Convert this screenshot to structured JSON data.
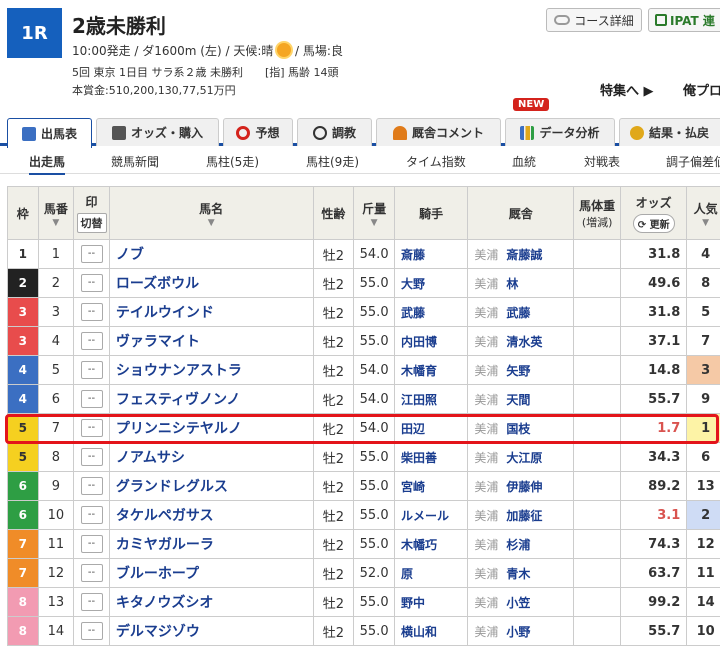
{
  "race": {
    "badge": "1R",
    "title": "2歳未勝利",
    "info_line1": "10:00発走 / ダ1600m (左) / 天候:晴",
    "info_line1b": "/ 馬場:良",
    "info_line2": "5回 東京 1日目 サラ系２歳 未勝利　　[指] 馬齢 14頭",
    "info_line3": "本賞金:510,200,130,77,51万円"
  },
  "header_buttons": {
    "course": "コース詳細",
    "ipat": "IPAT 連"
  },
  "header_links": {
    "feature": "特集へ ▶",
    "my": "俺プロ"
  },
  "tabs": [
    {
      "label": "出馬表",
      "icon": "table-icon",
      "color": "#3b6fc2"
    },
    {
      "label": "オッズ・購入",
      "icon": "ticket-icon",
      "color": "#555555"
    },
    {
      "label": "予想",
      "icon": "target-icon",
      "color": "#d4231c"
    },
    {
      "label": "調教",
      "icon": "stopwatch-icon",
      "color": "#333333"
    },
    {
      "label": "厩舎コメント",
      "icon": "stable-icon",
      "color": "#e07b1a"
    },
    {
      "label": "データ分析",
      "icon": "bar-chart-icon",
      "color": "#3b6fc2"
    },
    {
      "label": "結果・払戻",
      "icon": "coins-icon",
      "color": "#e0a81a"
    }
  ],
  "new_badge": "NEW",
  "subnav": [
    "出走馬",
    "競馬新聞",
    "馬柱(5走)",
    "馬柱(9走)",
    "タイム指数",
    "血統",
    "対戦表",
    "調子偏差値"
  ],
  "columns": {
    "waku": "枠",
    "umaban": "馬番",
    "mark": "印",
    "mark_toggle": "切替",
    "horse": "馬名",
    "sexage": "性齢",
    "weight": "斤量",
    "jockey": "騎手",
    "trainer": "厩舎",
    "body": "馬体重",
    "body_sub": "(増減)",
    "odds": "オッズ",
    "odds_update": "更新",
    "pop": "人気"
  },
  "mark_placeholder": "--",
  "colors": {
    "waku1": "#ffffff",
    "waku2": "#222222",
    "waku3": "#e84c4c",
    "waku4": "#3b6fc2",
    "waku5": "#f5d020",
    "waku6": "#2e9e44",
    "waku7": "#f08c28",
    "waku8": "#f29bb2",
    "pop1": "#fdf3a6",
    "pop2": "#cfdcf5",
    "pop3": "#f5c9a6",
    "highlight": "#e3141a"
  },
  "rows": [
    {
      "waku": "1",
      "umaban": "1",
      "horse": "ノブ",
      "sexage": "牡2",
      "weight": "54.0",
      "jockey": "斎藤",
      "region": "美浦",
      "trainer": "斎藤誠",
      "odds": "31.8",
      "pop": "4"
    },
    {
      "waku": "2",
      "umaban": "2",
      "horse": "ローズボウル",
      "sexage": "牡2",
      "weight": "55.0",
      "jockey": "大野",
      "region": "美浦",
      "trainer": "林",
      "odds": "49.6",
      "pop": "8"
    },
    {
      "waku": "3",
      "umaban": "3",
      "horse": "テイルウインド",
      "sexage": "牡2",
      "weight": "55.0",
      "jockey": "武藤",
      "region": "美浦",
      "trainer": "武藤",
      "odds": "31.8",
      "pop": "5"
    },
    {
      "waku": "3",
      "umaban": "4",
      "horse": "ヴァラマイト",
      "sexage": "牡2",
      "weight": "55.0",
      "jockey": "内田博",
      "region": "美浦",
      "trainer": "清水英",
      "odds": "37.1",
      "pop": "7"
    },
    {
      "waku": "4",
      "umaban": "5",
      "horse": "ショウナンアストラ",
      "sexage": "牡2",
      "weight": "54.0",
      "jockey": "木幡育",
      "region": "美浦",
      "trainer": "矢野",
      "odds": "14.8",
      "pop": "3"
    },
    {
      "waku": "4",
      "umaban": "6",
      "horse": "フェスティヴノンノ",
      "sexage": "牝2",
      "weight": "54.0",
      "jockey": "江田照",
      "region": "美浦",
      "trainer": "天間",
      "odds": "55.7",
      "pop": "9"
    },
    {
      "waku": "5",
      "umaban": "7",
      "horse": "プリンニシテヤルノ",
      "sexage": "牝2",
      "weight": "54.0",
      "jockey": "田辺",
      "region": "美浦",
      "trainer": "国枝",
      "odds": "1.7",
      "pop": "1"
    },
    {
      "waku": "5",
      "umaban": "8",
      "horse": "ノアムサシ",
      "sexage": "牡2",
      "weight": "55.0",
      "jockey": "柴田善",
      "region": "美浦",
      "trainer": "大江原",
      "odds": "34.3",
      "pop": "6"
    },
    {
      "waku": "6",
      "umaban": "9",
      "horse": "グランドレグルス",
      "sexage": "牡2",
      "weight": "55.0",
      "jockey": "宮崎",
      "region": "美浦",
      "trainer": "伊藤伸",
      "odds": "89.2",
      "pop": "13"
    },
    {
      "waku": "6",
      "umaban": "10",
      "horse": "タケルペガサス",
      "sexage": "牡2",
      "weight": "55.0",
      "jockey": "ルメール",
      "region": "美浦",
      "trainer": "加藤征",
      "odds": "3.1",
      "pop": "2"
    },
    {
      "waku": "7",
      "umaban": "11",
      "horse": "カミヤガルーラ",
      "sexage": "牡2",
      "weight": "55.0",
      "jockey": "木幡巧",
      "region": "美浦",
      "trainer": "杉浦",
      "odds": "74.3",
      "pop": "12"
    },
    {
      "waku": "7",
      "umaban": "12",
      "horse": "ブルーホープ",
      "sexage": "牡2",
      "weight": "52.0",
      "jockey": "原",
      "region": "美浦",
      "trainer": "青木",
      "odds": "63.7",
      "pop": "11"
    },
    {
      "waku": "8",
      "umaban": "13",
      "horse": "キタノウズシオ",
      "sexage": "牡2",
      "weight": "55.0",
      "jockey": "野中",
      "region": "美浦",
      "trainer": "小笠",
      "odds": "99.2",
      "pop": "14"
    },
    {
      "waku": "8",
      "umaban": "14",
      "horse": "デルマジゾウ",
      "sexage": "牡2",
      "weight": "55.0",
      "jockey": "横山和",
      "region": "美浦",
      "trainer": "小野",
      "odds": "55.7",
      "pop": "10"
    }
  ]
}
